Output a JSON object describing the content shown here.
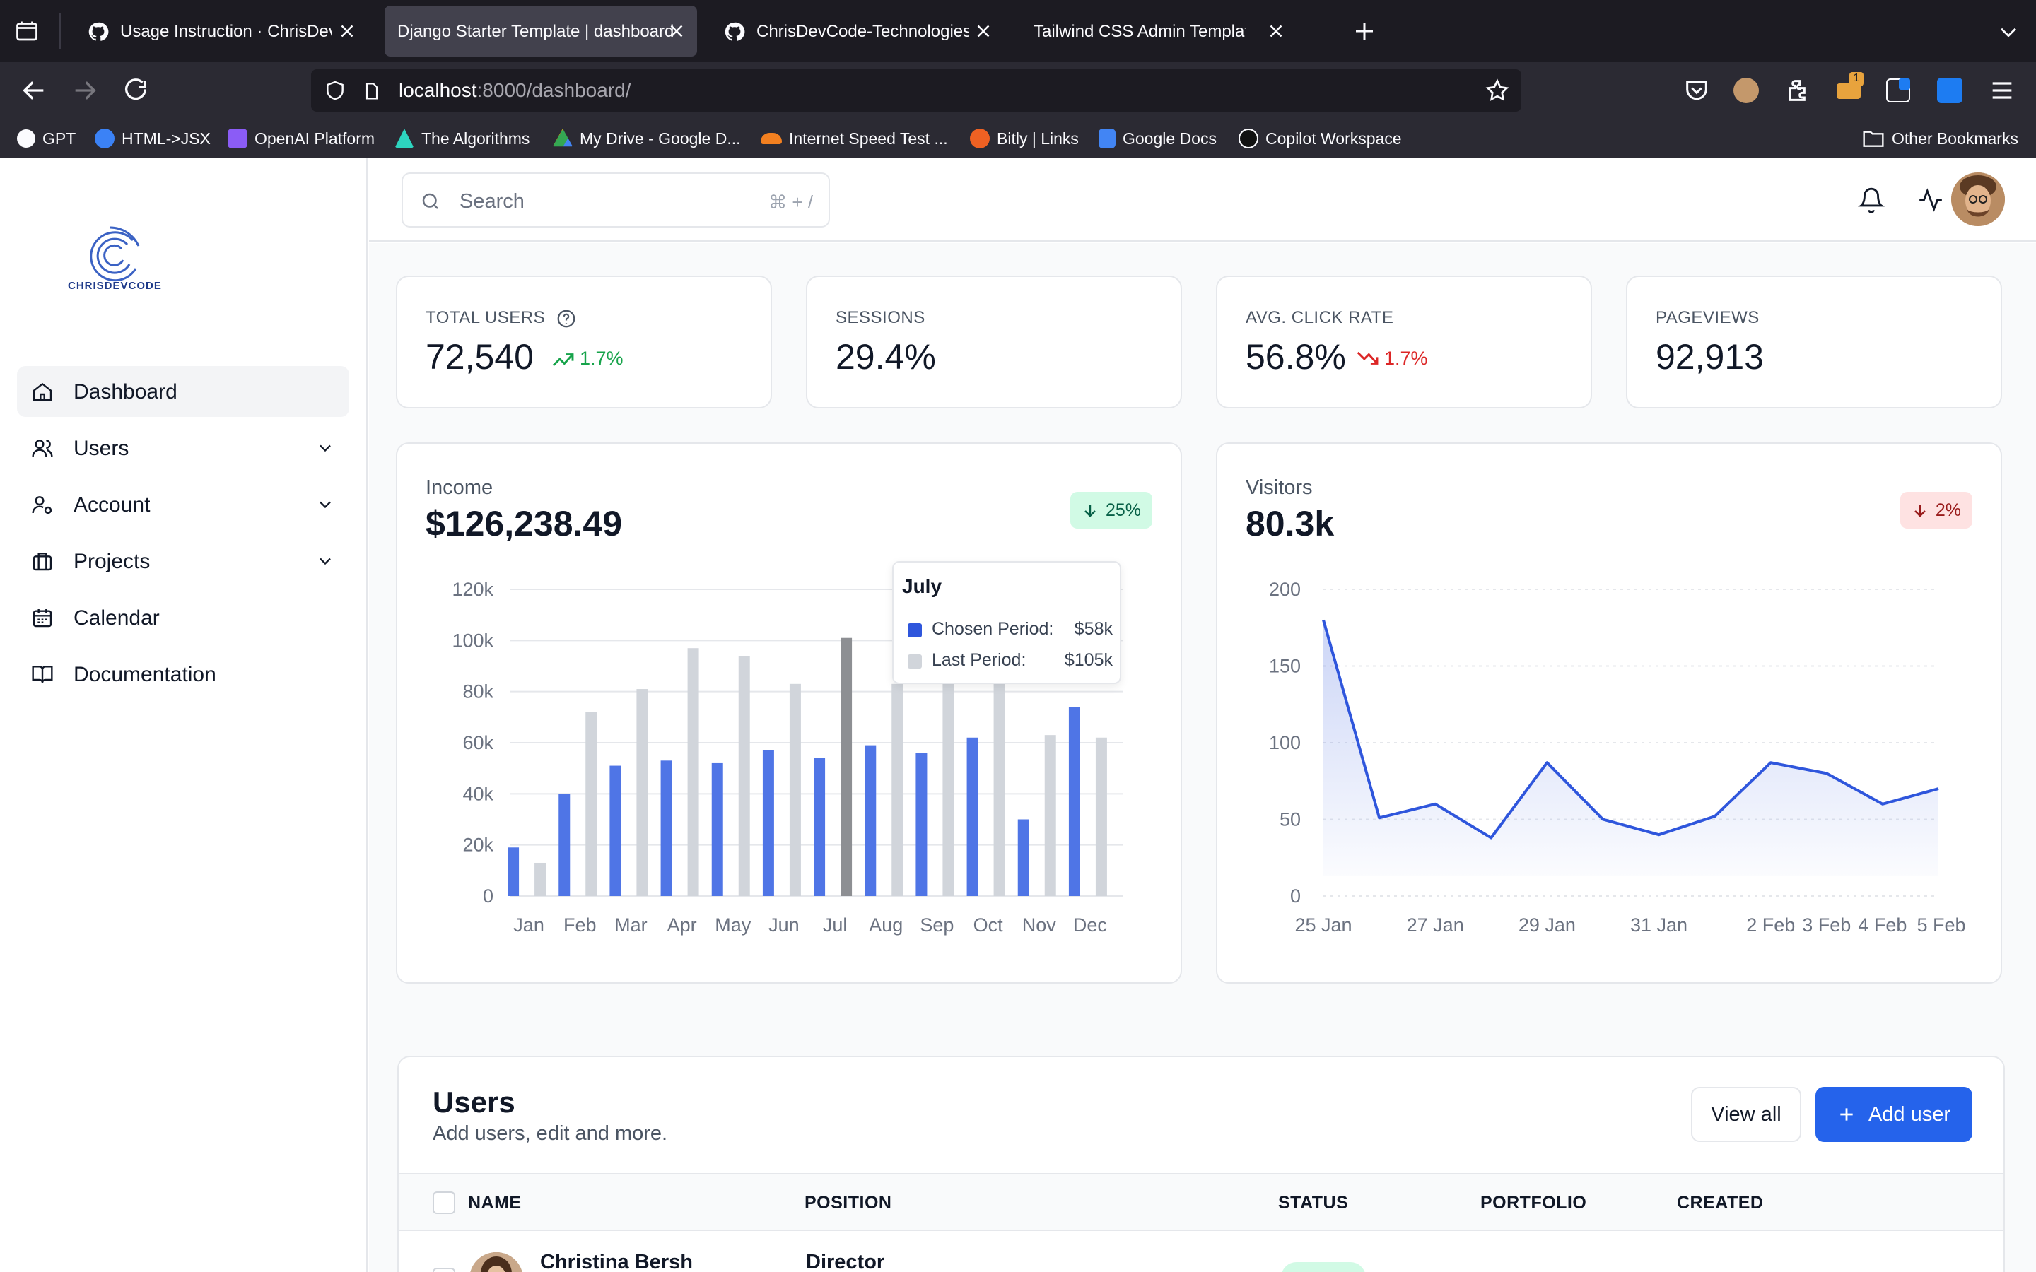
{
  "browser": {
    "tabs": [
      {
        "title": "Usage Instruction · ChrisDevCode",
        "icon": "github-icon",
        "active": false
      },
      {
        "title": "Django Starter Template | dashboard",
        "icon": "",
        "active": true
      },
      {
        "title": "ChrisDevCode-Technologies/django",
        "icon": "github-icon",
        "active": false
      },
      {
        "title": "Tailwind CSS Admin Template | Preline",
        "icon": "",
        "active": false
      }
    ],
    "url_host": "localhost",
    "url_rest": ":8000/dashboard/",
    "bookmarks": [
      "GPT",
      "HTML->JSX",
      "OpenAI Platform",
      "The Algorithms",
      "My Drive - Google D...",
      "Internet Speed Test ...",
      "Bitly | Links",
      "Google Docs",
      "Copilot Workspace"
    ],
    "other_bookmarks": "Other Bookmarks",
    "extension_badge": "1"
  },
  "sidebar": {
    "logo_text": "CHRISDEVCODE",
    "items": [
      {
        "label": "Dashboard",
        "icon": "home-icon",
        "active": true,
        "has_chevron": false
      },
      {
        "label": "Users",
        "icon": "users-icon",
        "active": false,
        "has_chevron": true
      },
      {
        "label": "Account",
        "icon": "user-settings-icon",
        "active": false,
        "has_chevron": true
      },
      {
        "label": "Projects",
        "icon": "briefcase-icon",
        "active": false,
        "has_chevron": true
      },
      {
        "label": "Calendar",
        "icon": "calendar-icon",
        "active": false,
        "has_chevron": false
      },
      {
        "label": "Documentation",
        "icon": "book-icon",
        "active": false,
        "has_chevron": false
      }
    ]
  },
  "topbar": {
    "search_placeholder": "Search",
    "search_shortcut": "⌘ + /"
  },
  "stats": [
    {
      "label": "TOTAL USERS",
      "value": "72,540",
      "change": "1.7%",
      "trend": "up",
      "help": true
    },
    {
      "label": "SESSIONS",
      "value": "29.4%",
      "change": "",
      "trend": "",
      "help": false
    },
    {
      "label": "AVG. CLICK RATE",
      "value": "56.8%",
      "change": "1.7%",
      "trend": "down",
      "help": false
    },
    {
      "label": "PAGEVIEWS",
      "value": "92,913",
      "change": "",
      "trend": "",
      "help": false
    }
  ],
  "income": {
    "label": "Income",
    "value": "$126,238.49",
    "badge": "25%",
    "tooltip": {
      "title": "July",
      "rows": [
        {
          "label": "Chosen Period:",
          "value": "$58k"
        },
        {
          "label": "Last Period:",
          "value": "$105k"
        }
      ]
    }
  },
  "visitors": {
    "label": "Visitors",
    "value": "80.3k",
    "badge": "2%"
  },
  "users": {
    "title": "Users",
    "subtitle": "Add users, edit and more.",
    "view_all": "View all",
    "add_user": "Add user",
    "columns": [
      "NAME",
      "POSITION",
      "STATUS",
      "PORTFOLIO",
      "CREATED"
    ],
    "rows": [
      {
        "name": "Christina Bersh",
        "position": "Director"
      }
    ]
  },
  "chart_data": [
    {
      "type": "bar",
      "categories": [
        "Jan",
        "Feb",
        "Mar",
        "Apr",
        "May",
        "Jun",
        "Jul",
        "Aug",
        "Sep",
        "Oct",
        "Nov",
        "Dec"
      ],
      "series": [
        {
          "name": "Chosen Period",
          "color": "#4f75e6",
          "values": [
            19,
            40,
            51,
            53,
            52,
            57,
            54,
            59,
            56,
            62,
            30,
            74
          ]
        },
        {
          "name": "Last Period",
          "color": "#d1d5db",
          "values": [
            13,
            72,
            81,
            97,
            94,
            83,
            101,
            83,
            84,
            84,
            63,
            62
          ]
        }
      ],
      "ylim": [
        0,
        120
      ],
      "yticks": [
        "0",
        "20k",
        "40k",
        "60k",
        "80k",
        "100k",
        "120k"
      ],
      "highlight": "Jul"
    },
    {
      "type": "area",
      "x": [
        "25 Jan",
        "26 Jan",
        "27 Jan",
        "28 Jan",
        "29 Jan",
        "30 Jan",
        "31 Jan",
        "1 Feb",
        "2 Feb",
        "3 Feb",
        "4 Feb",
        "5 Feb"
      ],
      "xticks": [
        "25 Jan",
        "27 Jan",
        "29 Jan",
        "31 Jan",
        "2 Feb",
        "3 Feb",
        "4 Feb",
        "5 Feb"
      ],
      "series": [
        {
          "color": "#2f56dc",
          "values": [
            180,
            51,
            60,
            38,
            87,
            50,
            40,
            52,
            87,
            80,
            60,
            70
          ]
        }
      ],
      "ylim": [
        0,
        200
      ],
      "yticks": [
        "0",
        "50",
        "100",
        "150",
        "200"
      ]
    }
  ]
}
